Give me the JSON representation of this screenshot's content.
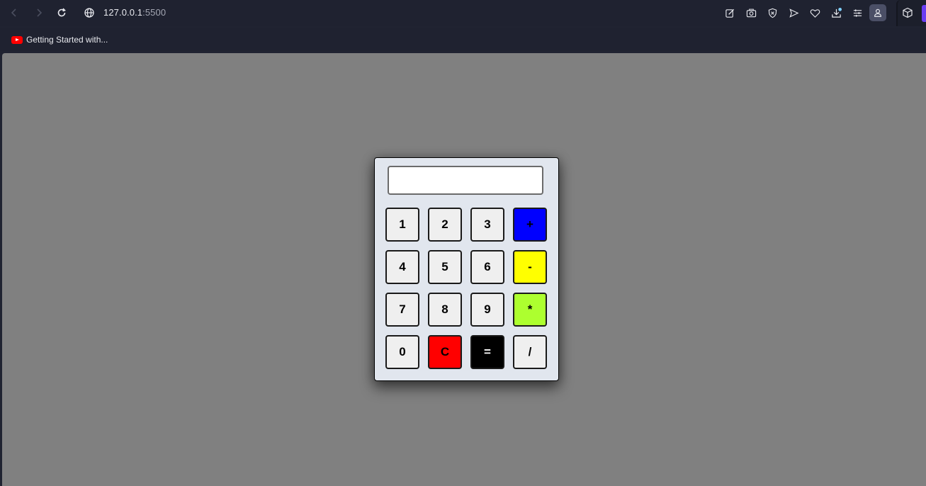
{
  "browser": {
    "url_host": "127.0.0.1",
    "url_port": ":5500",
    "bookmarks": [
      {
        "label": "Getting Started with..."
      }
    ]
  },
  "calculator": {
    "display_value": "",
    "keys": [
      {
        "label": "1",
        "color": "#efefef",
        "text_color": "#000000"
      },
      {
        "label": "2",
        "color": "#efefef",
        "text_color": "#000000"
      },
      {
        "label": "3",
        "color": "#efefef",
        "text_color": "#000000"
      },
      {
        "label": "+",
        "color": "#0000ff",
        "text_color": "#000000"
      },
      {
        "label": "4",
        "color": "#efefef",
        "text_color": "#000000"
      },
      {
        "label": "5",
        "color": "#efefef",
        "text_color": "#000000"
      },
      {
        "label": "6",
        "color": "#efefef",
        "text_color": "#000000"
      },
      {
        "label": "-",
        "color": "#ffff00",
        "text_color": "#000000"
      },
      {
        "label": "7",
        "color": "#efefef",
        "text_color": "#000000"
      },
      {
        "label": "8",
        "color": "#efefef",
        "text_color": "#000000"
      },
      {
        "label": "9",
        "color": "#efefef",
        "text_color": "#000000"
      },
      {
        "label": "*",
        "color": "#adff2f",
        "text_color": "#000000"
      },
      {
        "label": "0",
        "color": "#efefef",
        "text_color": "#000000"
      },
      {
        "label": "C",
        "color": "#ff0000",
        "text_color": "#000000"
      },
      {
        "label": "=",
        "color": "#000000",
        "text_color": "#ffffff"
      },
      {
        "label": "/",
        "color": "#efefef",
        "text_color": "#000000"
      }
    ]
  },
  "colors": {
    "page_background": "#808080",
    "calculator_body": "#e1e6ee",
    "browser_chrome": "#1f2230"
  }
}
